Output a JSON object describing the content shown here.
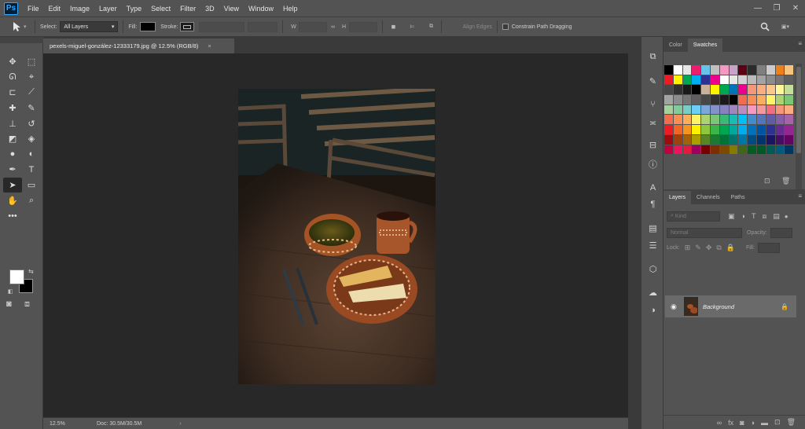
{
  "app": {
    "logo": "Ps"
  },
  "menu": [
    "File",
    "Edit",
    "Image",
    "Layer",
    "Type",
    "Select",
    "Filter",
    "3D",
    "View",
    "Window",
    "Help"
  ],
  "window_controls": {
    "minimize": "—",
    "restore": "❐",
    "close": "✕"
  },
  "options": {
    "select_label": "Select:",
    "select_value": "All Layers",
    "fill_label": "Fill:",
    "stroke_label": "Stroke:",
    "align_edges": "Align Edges",
    "constrain": "Constrain Path Dragging"
  },
  "document": {
    "tab_title": "pexels-miguel-gonzález-12333179.jpg @ 12.5% (RGB/8)",
    "tab_close": "×"
  },
  "status": {
    "zoom": "12.5%",
    "doc": "Doc: 30.5M/30.5M"
  },
  "swatches_panel": {
    "tabs": [
      "Color",
      "Swatches"
    ],
    "active_tab": "Swatches",
    "colors": [
      "#000000",
      "#ffffff",
      "#e6e6e6",
      "#ed1c6c",
      "#66c2e8",
      "#bfbfbf",
      "#f49ac1",
      "#c8a2c8",
      "#5d0015",
      "#2b2b2b",
      "#7f7f7f",
      "#cbcbcb",
      "#ef7f1a",
      "#f6c47e",
      "#ed1c24",
      "#fff200",
      "#00a651",
      "#00aeef",
      "#2e3192",
      "#ec008c",
      "#ffffff",
      "#e6e6e6",
      "#d1d1d1",
      "#bababa",
      "#a3a3a3",
      "#8c8c8c",
      "#757575",
      "#5e5e5e",
      "#474747",
      "#303030",
      "#1a1a1a",
      "#000000",
      "#c7b299",
      "#fff200",
      "#00a651",
      "#0072bc",
      "#ec008c",
      "#f7977a",
      "#f9ad81",
      "#fdc68a",
      "#fff79a",
      "#c4df9b",
      "#a3a3a3",
      "#8c8c8c",
      "#757575",
      "#5e5e5e",
      "#474747",
      "#303030",
      "#1a1a1a",
      "#000000",
      "#f26c4f",
      "#f68e55",
      "#fbaf5c",
      "#fff467",
      "#acd372",
      "#7cc576",
      "#a3d39c",
      "#82ca9c",
      "#7accc8",
      "#6dcff6",
      "#7da7d9",
      "#8393ca",
      "#8781bd",
      "#a186be",
      "#bd8cbf",
      "#f49ac1",
      "#f5989d",
      "#f26d7d",
      "#f7977a",
      "#f9ad81",
      "#f26c4f",
      "#f68e55",
      "#fbaf5c",
      "#fff467",
      "#acd372",
      "#7cc576",
      "#3bb878",
      "#1abbb4",
      "#00bff3",
      "#438ccb",
      "#5574b9",
      "#605ca8",
      "#855fa8",
      "#a763a8",
      "#ed1c24",
      "#f26522",
      "#f7941d",
      "#fff200",
      "#8dc63f",
      "#39b54a",
      "#00a651",
      "#00a99d",
      "#00aeef",
      "#0072bc",
      "#0054a6",
      "#2e3192",
      "#662d91",
      "#92278f",
      "#9e0b0f",
      "#a0410d",
      "#a36209",
      "#aba000",
      "#598527",
      "#1a7b30",
      "#007236",
      "#00746b",
      "#0076a3",
      "#004b80",
      "#003471",
      "#1b1464",
      "#440e62",
      "#630460",
      "#bf0041",
      "#ed145b",
      "#e21b3c",
      "#9e005d",
      "#790000",
      "#7b2e00",
      "#7d4900",
      "#827b00",
      "#406618",
      "#005e20",
      "#005826",
      "#005952",
      "#005b7f",
      "#003663"
    ]
  },
  "layers_panel": {
    "tabs": [
      "Layers",
      "Channels",
      "Paths"
    ],
    "active_tab": "Layers",
    "filter_placeholder": "Kind",
    "blend_mode": "Normal",
    "opacity_label": "Opacity:",
    "lock_label": "Lock:",
    "fill_label": "Fill:",
    "layers": [
      {
        "name": "Background",
        "visible": true,
        "locked": true
      }
    ]
  }
}
